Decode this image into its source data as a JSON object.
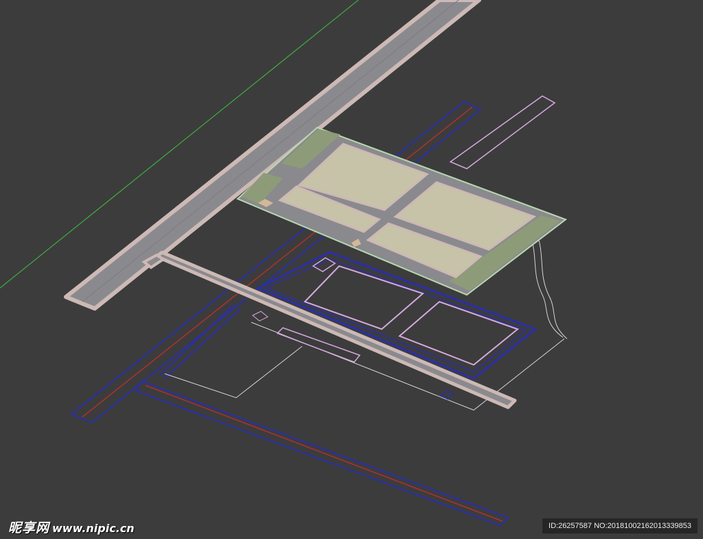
{
  "colors": {
    "background": "#3c3c3c",
    "road_fill": "#8a8a8e",
    "road_edge": "#cdb9b5",
    "plaza_fill": "#c7c3a8",
    "grass_fill": "#8e9b78",
    "plot_outline": "#d6a9e0",
    "blue_road": "#2a2fa8",
    "red_centerline": "#b03030",
    "green_line": "#3fae3f",
    "pale_line": "#d9d2d8"
  },
  "watermark": {
    "logo_text": "昵享网",
    "url_text": "www.nipic.cn",
    "id_text": "ID:26257587 NO:20181002162013339853"
  }
}
